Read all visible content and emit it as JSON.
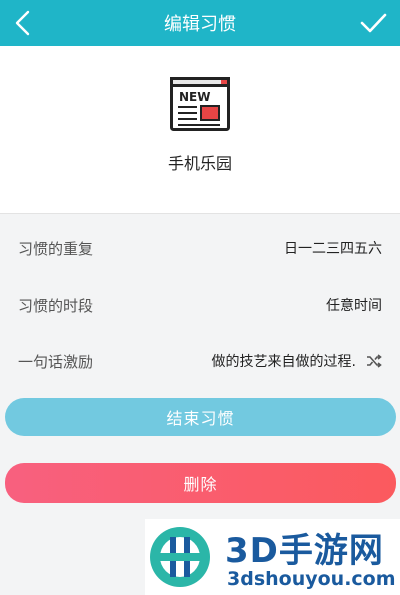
{
  "topbar": {
    "title": "编辑习惯"
  },
  "habit": {
    "name": "手机乐园",
    "icon_text": "NEW"
  },
  "rows": [
    {
      "label": "习惯的重复",
      "value": "日一二三四五六"
    },
    {
      "label": "习惯的时段",
      "value": "任意时间"
    },
    {
      "label": "一句话激励",
      "value": "做的技艺来自做的过程."
    }
  ],
  "buttons": {
    "end": "结束习惯",
    "delete": "删除"
  },
  "watermark": {
    "brand": "3D手游网",
    "url": "3dshouyou.com"
  },
  "colors": {
    "topbar": "#1fb5c8",
    "end_button": "#72c9e0",
    "delete_button": "#fb5a6e"
  }
}
